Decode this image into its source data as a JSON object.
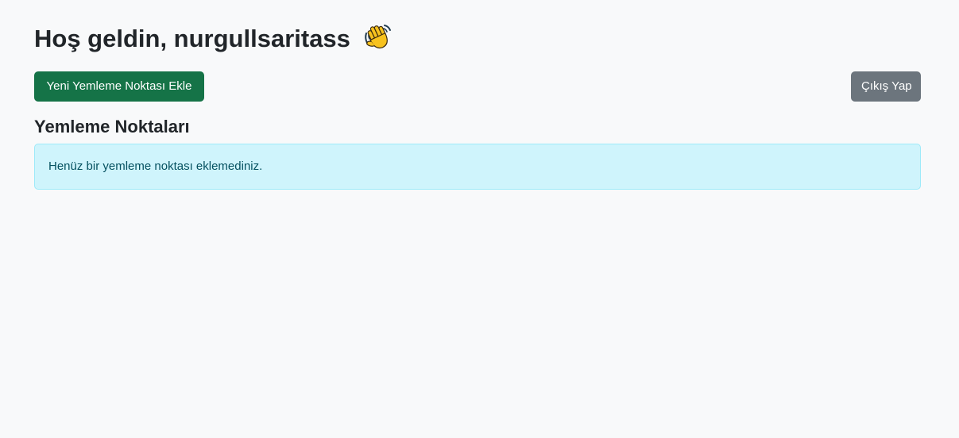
{
  "header": {
    "greeting": "Hoş geldin, nurgullsaritass",
    "greeting_icon": "waving-hand-icon"
  },
  "actions": {
    "add_label": "Yeni Yemleme Noktası Ekle",
    "logout_label": "Çıkış Yap"
  },
  "feeding_points": {
    "title": "Yemleme Noktaları",
    "empty_message": "Henüz bir yemleme noktası eklemediniz."
  },
  "colors": {
    "page_background": "#f8f9fa",
    "add_button": "#157347",
    "logout_button": "#6c757d",
    "info_alert_background": "#cff4fc",
    "info_alert_text": "#055160"
  }
}
